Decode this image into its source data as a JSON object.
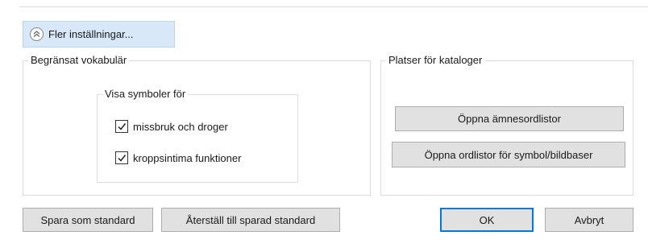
{
  "more_settings": {
    "label": "Fler inställningar...",
    "icon": "double-chevron-up-icon"
  },
  "vocabulary": {
    "legend": "Begränsat vokabulär",
    "symbols": {
      "legend": "Visa symboler för",
      "options": [
        {
          "label": "missbruk och droger",
          "checked": true
        },
        {
          "label": "kroppsintima funktioner",
          "checked": true
        }
      ]
    }
  },
  "catalogs": {
    "legend": "Platser för kataloger",
    "open_subject_lists": "Öppna ämnesordlistor",
    "open_symbol_lists": "Öppna ordlistor för symbol/bildbaser"
  },
  "footer": {
    "save_default": "Spara som standard",
    "restore_default": "Återställ till sparad standard",
    "ok": "OK",
    "cancel": "Avbryt"
  },
  "colors": {
    "accent_border": "#0078d7",
    "more_settings_bg": "#d8e8f8"
  }
}
